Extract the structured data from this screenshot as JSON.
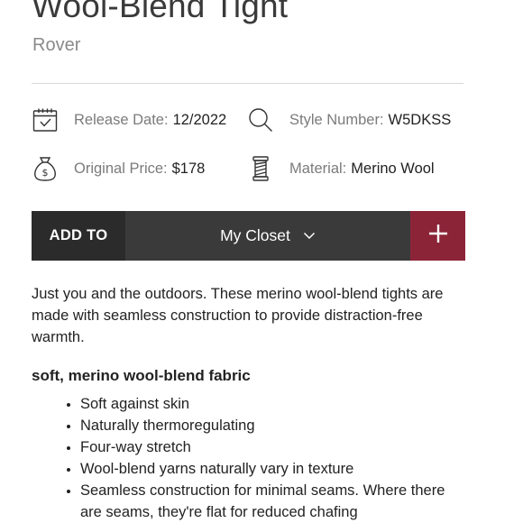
{
  "product": {
    "title": "Wool-Blend Tight",
    "brand": "Rover"
  },
  "specs": {
    "release": {
      "label": "Release Date:",
      "value": "12/2022",
      "icon": "calendar-icon"
    },
    "style": {
      "label": "Style Number:",
      "value": "W5DKSS",
      "icon": "search-icon"
    },
    "price": {
      "label": "Original Price:",
      "value": "$178",
      "icon": "money-bag-icon"
    },
    "material": {
      "label": "Material:",
      "value": "Merino Wool",
      "icon": "yarn-spool-icon"
    }
  },
  "closet_bar": {
    "add_to_label": "ADD TO",
    "selected_closet": "My Closet",
    "plus_color": "#8c2438"
  },
  "description": "Just you and the outdoors. These merino wool-blend tights are made with seamless construction to provide distraction-free warmth.",
  "features": {
    "heading": "soft, merino wool-blend fabric",
    "items": [
      "Soft against skin",
      "Naturally thermoregulating",
      "Four-way stretch",
      "Wool-blend yarns naturally vary in texture",
      "Seamless construction for minimal seams. Where there are seams, they're flat for reduced chafing"
    ]
  }
}
